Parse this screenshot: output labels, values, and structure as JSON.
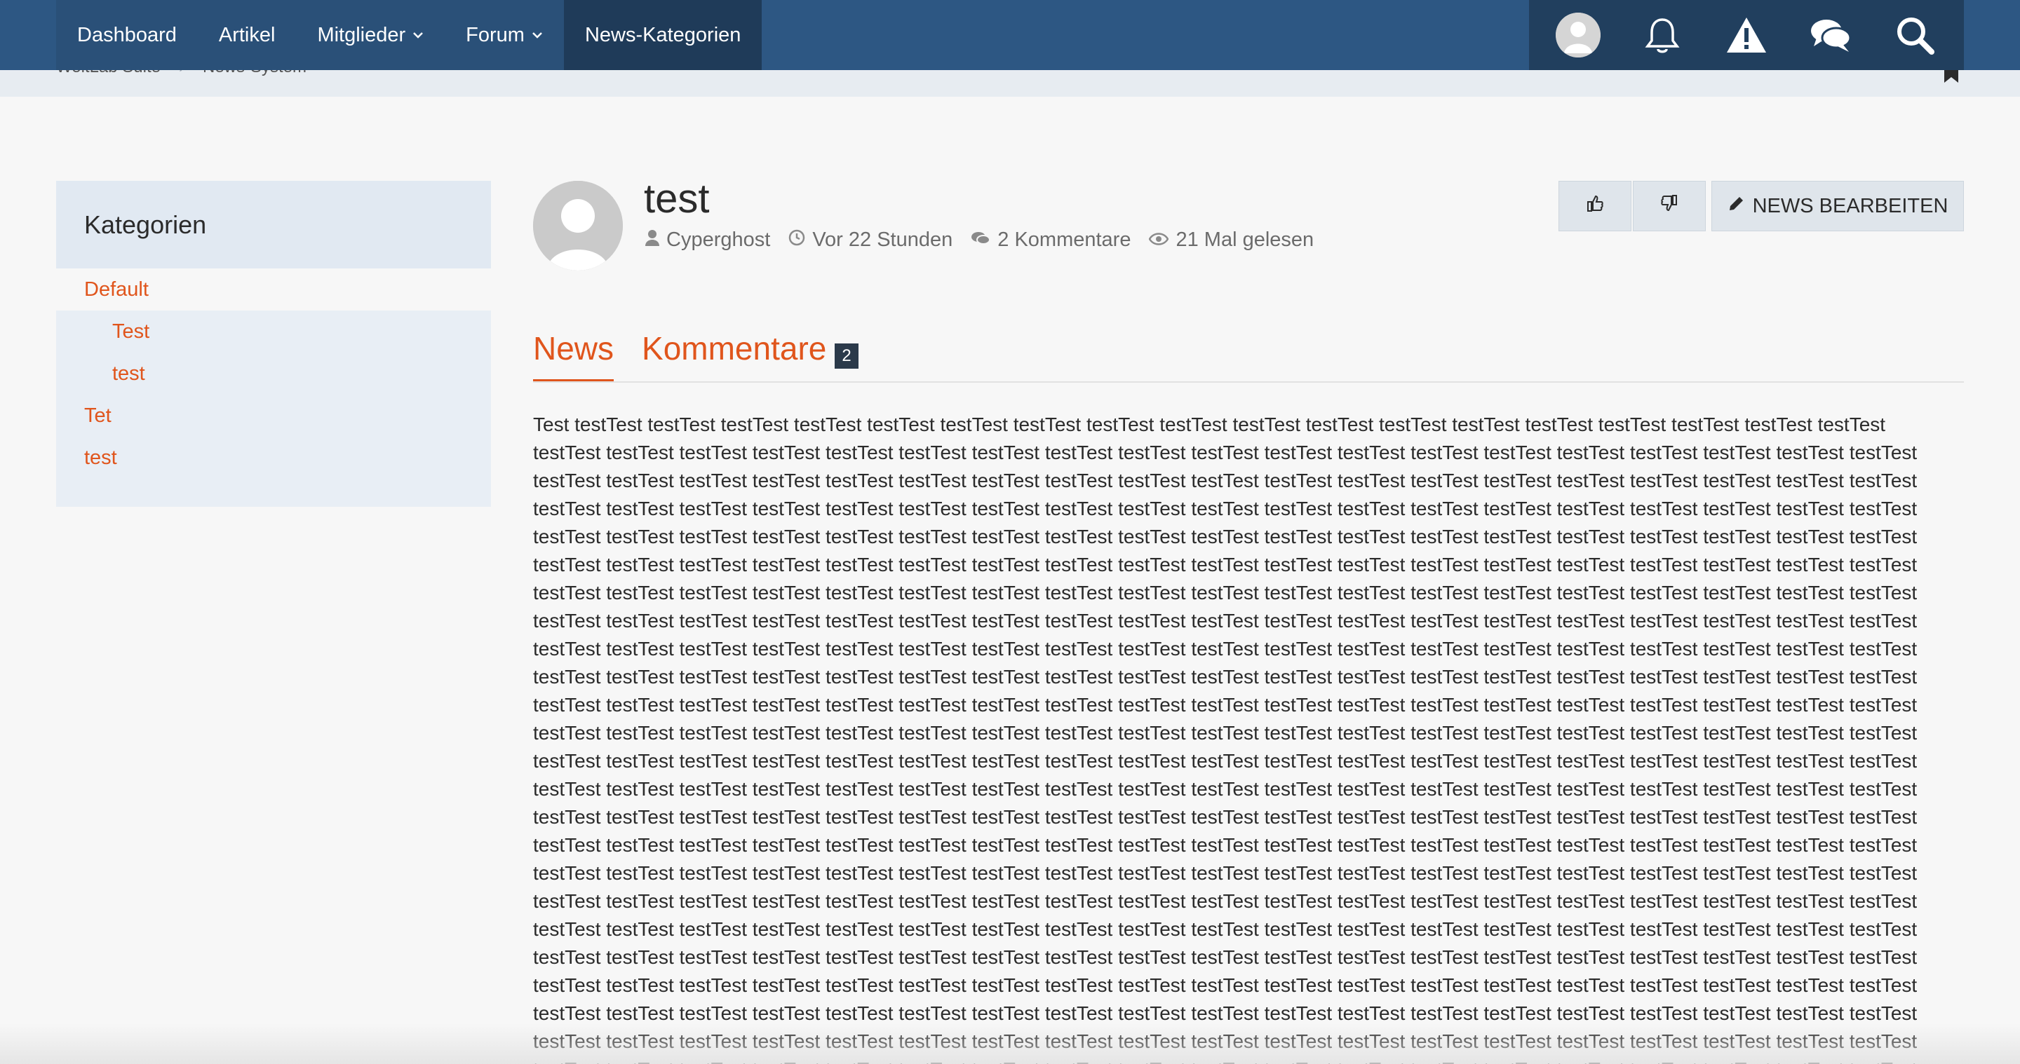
{
  "nav": {
    "items": [
      {
        "label": "Dashboard",
        "dropdown": false,
        "active": false
      },
      {
        "label": "Artikel",
        "dropdown": false,
        "active": false
      },
      {
        "label": "Mitglieder",
        "dropdown": true,
        "active": false
      },
      {
        "label": "Forum",
        "dropdown": true,
        "active": false
      },
      {
        "label": "News-Kategorien",
        "dropdown": false,
        "active": true
      }
    ],
    "user_icons": [
      "user-avatar-icon",
      "bell-icon",
      "warning-icon",
      "chat-icon",
      "search-icon"
    ]
  },
  "breadcrumb": [
    "WoltLab Suite",
    "News-System"
  ],
  "sidebar": {
    "title": "Kategorien",
    "default": "Default",
    "sub": [
      "Test",
      "test"
    ],
    "top": [
      "Tet",
      "test"
    ]
  },
  "news": {
    "title": "test",
    "author": "Cyperghost",
    "time": "Vor 22 Stunden",
    "comments": "2 Kommentare",
    "views": "21 Mal gelesen",
    "edit_label": "NEWS BEARBEITEN"
  },
  "tabs": {
    "news": "News",
    "comments": "Kommentare",
    "comments_count": "2"
  },
  "content": {
    "first_line": "Test testTest testTest testTest testTest testTest testTest testTest testTest testTest testTest testTest testTest testTest testTest testTest testTest testTest testTest",
    "line": "testTest testTest testTest testTest testTest testTest testTest testTest testTest testTest testTest testTest testTest testTest testTest testTest testTest testTest testTest"
  },
  "colors": {
    "nav_bg": "#2d5783",
    "accent": "#e0551c",
    "sidebar_bg": "#e8eef5"
  }
}
